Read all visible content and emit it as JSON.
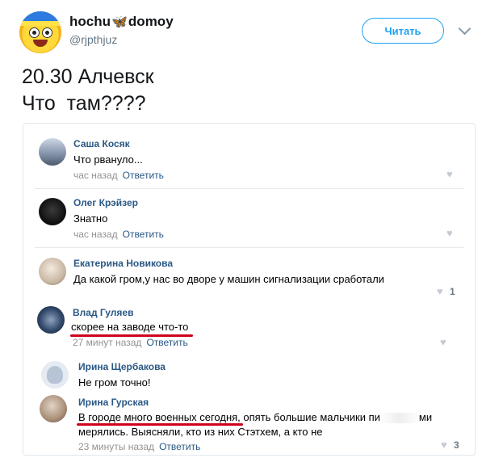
{
  "header": {
    "name_part1": "hochu",
    "name_symbol": "🦋",
    "name_part2": "domoy",
    "handle": "@rjpthjuz",
    "follow_label": "Читать"
  },
  "tweet": {
    "text": "20.30 Алчевск\nЧто  там????"
  },
  "comments": [
    {
      "author": "Саша Косяк",
      "text": "Что рвануло...",
      "time": "час назад",
      "reply": "Ответить",
      "likes": ""
    },
    {
      "author": "Олег Крэйзер",
      "text": "Знатно",
      "time": "час назад",
      "reply": "Ответить",
      "likes": ""
    },
    {
      "author": "Екатерина Новикова",
      "text": "Да какой гром,у нас во дворе у машин сигнализации сработали",
      "time": "",
      "reply": "",
      "likes": "1"
    },
    {
      "author": "Влад Гуляев",
      "text": "скорее на заводе что-то",
      "time": "27 минут назад",
      "reply": "Ответить",
      "likes": ""
    },
    {
      "author": "Ирина Щербакова",
      "text": "Не гром точно!",
      "time": "",
      "reply": "",
      "likes": ""
    },
    {
      "author": "Ирина Гурская",
      "text_line1a": "В городе много военных сегодня, опять большие мальчики пи",
      "text_line1b": "ми",
      "text_line2": "мерялись. Выясняли, кто из них Стэтхем, а кто не",
      "time": "23 минуты назад",
      "reply": "Ответить",
      "likes": "3"
    }
  ],
  "colors": {
    "accent": "#1da1f2",
    "vk_link": "#2a5885",
    "underline": "#d0021b"
  }
}
